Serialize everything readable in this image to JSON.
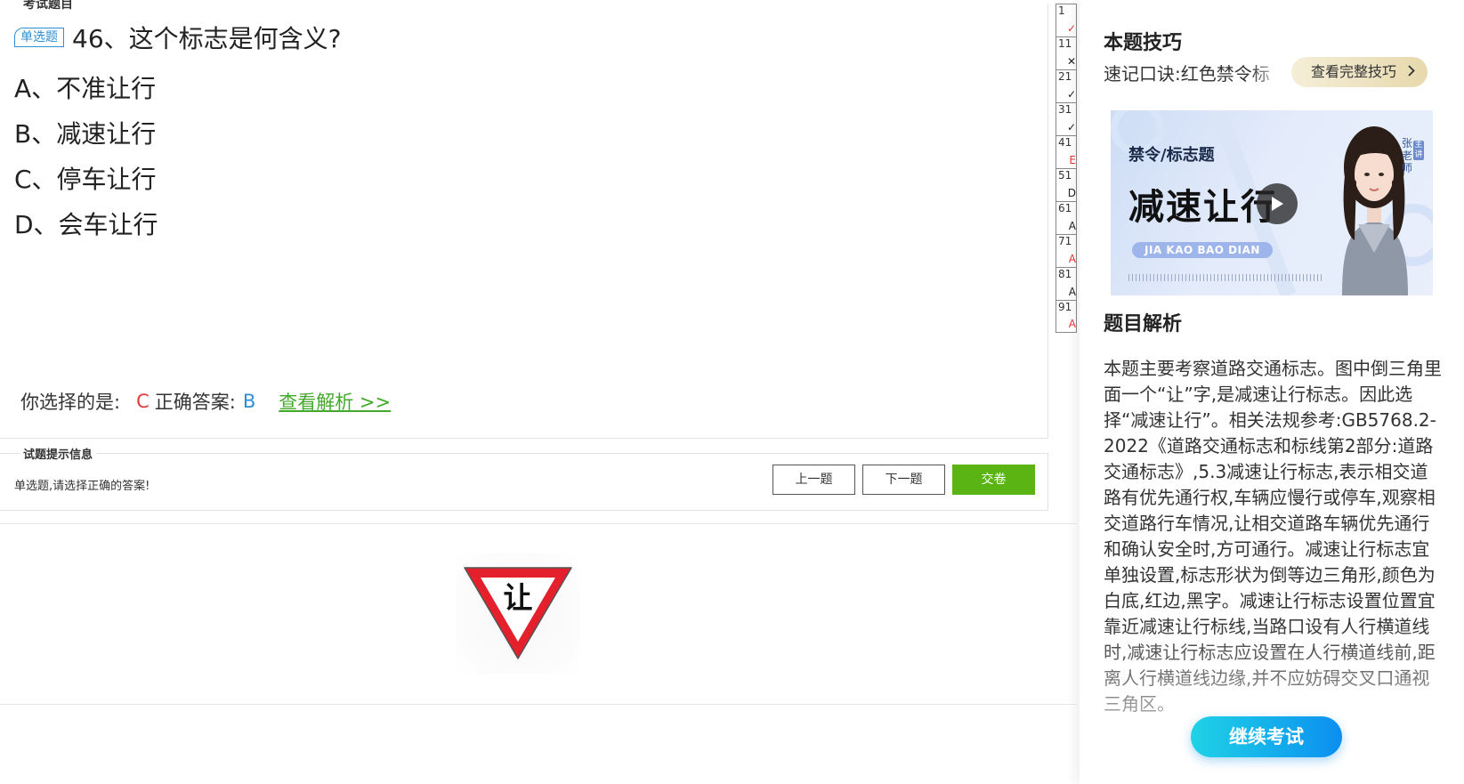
{
  "question_panel": {
    "legend": "考试题目",
    "badge": "单选题",
    "title": "46、这个标志是何含义?",
    "options": [
      "A、不准让行",
      "B、减速让行",
      "C、停车让行",
      "D、会车让行"
    ],
    "your_choice_label": "你选择的是:",
    "your_choice": "C",
    "correct_label": "正确答案:",
    "correct_answer": "B",
    "view_analysis_link": "查看解析 >>"
  },
  "hint_section": {
    "legend": "试题提示信息",
    "text": "单选题,请选择正确的答案!",
    "prev_button": "上一题",
    "next_button": "下一题",
    "submit_button": "交卷"
  },
  "sign_image": {
    "char": "让",
    "colors": {
      "border": "#e4202c",
      "fill": "#ffffff",
      "text": "#111111"
    }
  },
  "question_grid": [
    {
      "num": "1",
      "mark": "✓",
      "color": "#e4393c"
    },
    {
      "num": "11",
      "mark": "✕",
      "color": "#222222"
    },
    {
      "num": "21",
      "mark": "✓",
      "color": "#222222"
    },
    {
      "num": "31",
      "mark": "✓",
      "color": "#222222"
    },
    {
      "num": "41",
      "mark": "E",
      "color": "#e4393c"
    },
    {
      "num": "51",
      "mark": "D",
      "color": "#222222"
    },
    {
      "num": "61",
      "mark": "A",
      "color": "#222222"
    },
    {
      "num": "71",
      "mark": "A",
      "color": "#e4393c"
    },
    {
      "num": "81",
      "mark": "A",
      "color": "#222222"
    },
    {
      "num": "91",
      "mark": "A",
      "color": "#e4393c"
    }
  ],
  "right_panel": {
    "tips_title": "本题技巧",
    "tips_text": "速记口诀:红色禁令标",
    "tips_button": "查看完整技巧",
    "video": {
      "category": "禁令/标志题",
      "headline": "减速让行",
      "tag": "JIA KAO BAO DIAN",
      "teacher": "张老师",
      "role": "主讲"
    },
    "analysis_title": "题目解析",
    "analysis_text": "本题主要考察道路交通标志。图中倒三角里面一个“让”字,是减速让行标志。因此选择“减速让行”。相关法规参考:GB5768.2-2022《道路交通标志和标线第2部分:道路交通标志》,5.3减速让行标志,表示相交道路有优先通行权,车辆应慢行或停车,观察相交道路行车情况,让相交道路车辆优先通行和确认安全时,方可通行。减速让行标志宜单独设置,标志形状为倒等边三角形,颜色为白底,红边,黑字。减速让行标志设置位置宜靠近减速让行标线,当路口设有人行横道线时,减速让行标志应设置在人行横道线前,距离人行横道线边缘,并不应妨碍交叉口通视三角区。",
    "continue_button": "继续考试"
  }
}
